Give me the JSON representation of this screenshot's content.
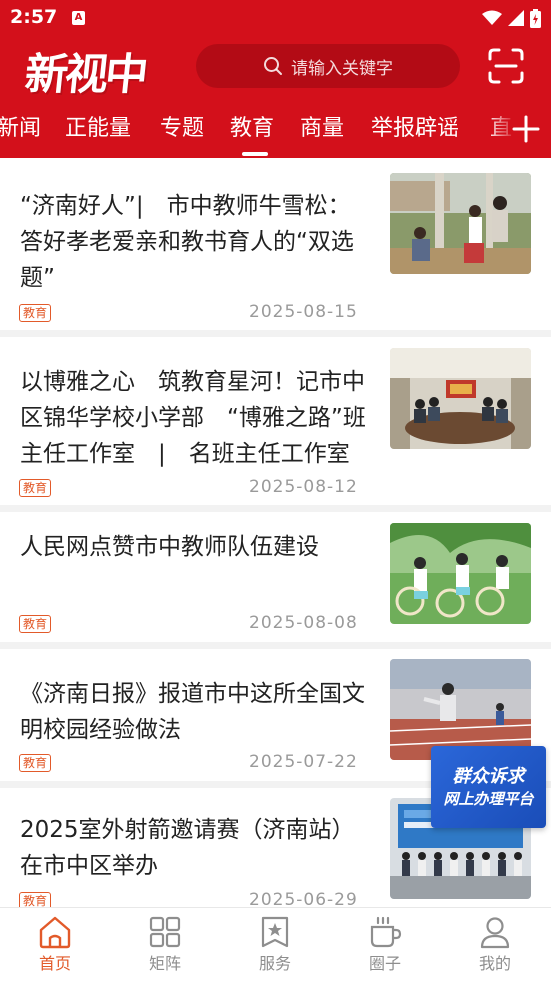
{
  "status_bar": {
    "time": "2:57",
    "app_icon_letter": "A"
  },
  "header": {
    "logo_text": "新视中",
    "search_placeholder": "请输入关键字",
    "background_color": "#d3101b"
  },
  "channels": {
    "items": [
      "新闻",
      "正能量",
      "专题",
      "教育",
      "商量",
      "举报辟谣",
      "直"
    ],
    "active": "教育"
  },
  "news": [
    {
      "title": "“济南好人”|　市中教师牛雪松：答好孝老爱亲和教书育人的“双选题”",
      "tag": "教育",
      "date": "2025-08-15",
      "thumb": "photo-teachers-with-family-outdoors"
    },
    {
      "title": "以博雅之心　筑教育星河！记市中区锦华学校小学部　“博雅之路”班主任工作室　|　名班主任工作室",
      "tag": "教育",
      "date": "2025-08-12",
      "thumb": "photo-meeting-room"
    },
    {
      "title": "人民网点赞市中教师队伍建设",
      "tag": "教育",
      "date": "2025-08-08",
      "thumb": "photo-students-dancing-with-fans"
    },
    {
      "title": "《济南日报》报道市中这所全国文明校园经验做法",
      "tag": "教育",
      "date": "2025-07-22",
      "thumb": "photo-school-track-event"
    },
    {
      "title": "2025室外射箭邀请赛（济南站）在市中区举办",
      "tag": "教育",
      "date": "2025-06-29",
      "thumb": "photo-archery-group"
    }
  ],
  "float_banner": {
    "line1": "群众诉求",
    "line2": "网上办理平台"
  },
  "bottom_nav": [
    {
      "label": "首页",
      "icon": "home-icon",
      "active": true
    },
    {
      "label": "矩阵",
      "icon": "grid-icon",
      "active": false
    },
    {
      "label": "服务",
      "icon": "star-bookmark-icon",
      "active": false
    },
    {
      "label": "圈子",
      "icon": "cup-icon",
      "active": false
    },
    {
      "label": "我的",
      "icon": "user-icon",
      "active": false
    }
  ],
  "colors": {
    "brand_red": "#d3101b",
    "accent_orange": "#e25a2a",
    "date_gray": "#9a9a9a"
  }
}
